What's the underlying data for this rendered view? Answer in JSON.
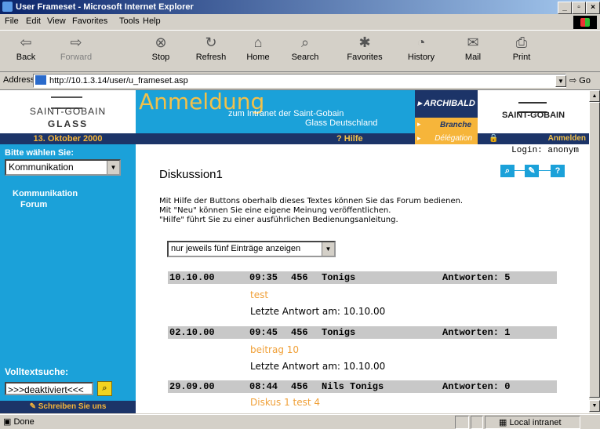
{
  "window": {
    "title": "User Frameset - Microsoft Internet Explorer"
  },
  "menu": [
    "File",
    "Edit",
    "View",
    "Favorites",
    "Tools",
    "Help"
  ],
  "toolbar": {
    "back": "Back",
    "forward": "Forward",
    "stop": "Stop",
    "refresh": "Refresh",
    "home": "Home",
    "search": "Search",
    "favorites": "Favorites",
    "history": "History",
    "mail": "Mail",
    "print": "Print"
  },
  "address": {
    "label": "Address",
    "url": "http://10.1.3.14/user/u_frameset.asp",
    "go": "Go"
  },
  "logo_left": {
    "line1": "SAINT-GOBAIN",
    "line2": "GLASS"
  },
  "date": "13. Oktober 2000",
  "sidebar": {
    "title": "Bitte wählen Sie:",
    "select_value": "Kommunikation",
    "nav1": "Kommunikation",
    "nav2": "Forum",
    "search_title": "Volltextsuche:",
    "search_value": ">>>deaktiviert<<<",
    "write": "Schreiben Sie uns"
  },
  "banner": {
    "title": "Anmeldung",
    "sub1": "zum Intranet der Saint-Gobain",
    "sub2": "Glass Deutschland",
    "archibald": "ARCHIBALD",
    "branche": "Branche",
    "logo_right": "SAINT-GOBAIN"
  },
  "nav": {
    "hilfe": "? Hilfe",
    "delegation": "Délégation",
    "anmelden": "Anmelden"
  },
  "content": {
    "login": "Login: anonym",
    "heading": "Diskussion1",
    "intro": [
      "Mit Hilfe der Buttons oberhalb dieses Textes können Sie das Forum bedienen.",
      "Mit \"Neu\" können Sie eine eigene Meinung veröffentlichen.",
      "\"Hilfe\" führt Sie zu einer ausführlichen Bedienungsanleitung."
    ],
    "filter": "nur jeweils fünf Einträge anzeigen",
    "posts": [
      {
        "date": "10.10.00",
        "time": "09:35",
        "id": "456",
        "author": "Tonigs",
        "answers": "Antworten: 5",
        "title": "test",
        "last": "Letzte Antwort am: 10.10.00"
      },
      {
        "date": "02.10.00",
        "time": "09:45",
        "id": "456",
        "author": "Tonigs",
        "answers": "Antworten: 1",
        "title": "beitrag 10",
        "last": "Letzte Antwort am: 10.10.00"
      },
      {
        "date": "29.09.00",
        "time": "08:44",
        "id": "456",
        "author": "Nils Tonigs",
        "answers": "Antworten: 0",
        "title": "Diskus 1 test 4",
        "last": ""
      }
    ]
  },
  "status": {
    "text": "Done",
    "zone": "Local intranet"
  }
}
